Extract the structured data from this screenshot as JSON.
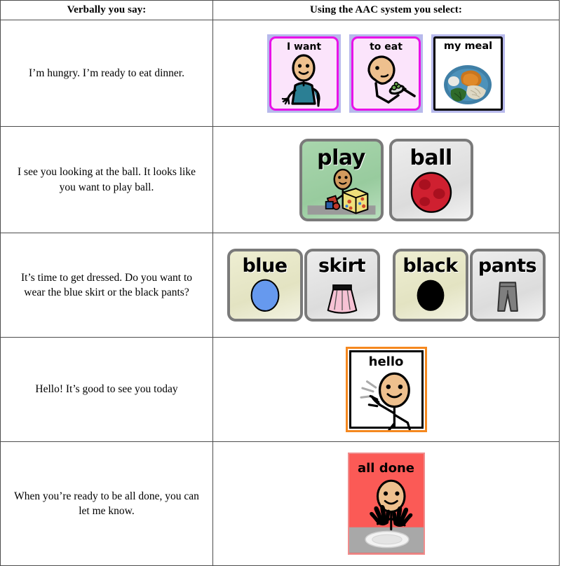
{
  "table": {
    "headers": {
      "left": "Verbally you say:",
      "right": "Using the AAC system you select:"
    },
    "rows": [
      {
        "say": "I’m hungry. I’m ready to eat dinner.",
        "symbols": [
          {
            "label": "I want",
            "style": "magenta-folder",
            "art": "person-pointing-self",
            "bg": "#fbe4fb",
            "frame": "#e812e8",
            "outer": "#b7b9ec"
          },
          {
            "label": "to eat",
            "style": "magenta-folder",
            "art": "person-eating-fork",
            "bg": "#fbe4fb",
            "frame": "#e812e8",
            "outer": "#b7b9ec"
          },
          {
            "label": "my meal",
            "style": "photo",
            "art": "plate-of-food-photo",
            "bg": "#ffffff",
            "frame": "#000000",
            "outer": "#b7b9ec"
          }
        ]
      },
      {
        "say": "I see you looking at the ball. It looks like you want to play ball.",
        "symbols": [
          {
            "label": "play",
            "style": "grey-bevel",
            "art": "child-with-blocks",
            "bg": "#a9d6ad",
            "frame": "#7a7a7a"
          },
          {
            "label": "ball",
            "style": "grey-bevel",
            "art": "red-ball",
            "bg": "#e4e4e4",
            "frame": "#7a7a7a"
          }
        ]
      },
      {
        "say": "It’s time to get dressed. Do you want to wear the blue skirt or the black pants?",
        "symbols": [
          {
            "label": "blue",
            "style": "grey-bevel",
            "art": "blue-oval",
            "bg": "#e9e9cf",
            "frame": "#7a7a7a"
          },
          {
            "label": "skirt",
            "style": "grey-bevel",
            "art": "pink-skirt",
            "bg": "#e0e0e0",
            "frame": "#7a7a7a"
          },
          {
            "label": "black",
            "style": "grey-bevel",
            "art": "black-oval",
            "bg": "#e9e9cf",
            "frame": "#7a7a7a"
          },
          {
            "label": "pants",
            "style": "grey-bevel",
            "art": "grey-pants",
            "bg": "#e0e0e0",
            "frame": "#7a7a7a"
          }
        ]
      },
      {
        "say": "Hello! It’s good to see you today",
        "symbols": [
          {
            "label": "hello",
            "style": "orange-black-frame",
            "art": "person-waving",
            "bg": "#ffffff",
            "frame": "#f5881f"
          }
        ]
      },
      {
        "say": "When you’re ready to be all done, you can let me know.",
        "symbols": [
          {
            "label": "all done",
            "style": "red-plain",
            "art": "person-hands-up-empty-plate",
            "bg": "#fb5a56",
            "frame": "#f08c8c"
          }
        ]
      }
    ]
  }
}
